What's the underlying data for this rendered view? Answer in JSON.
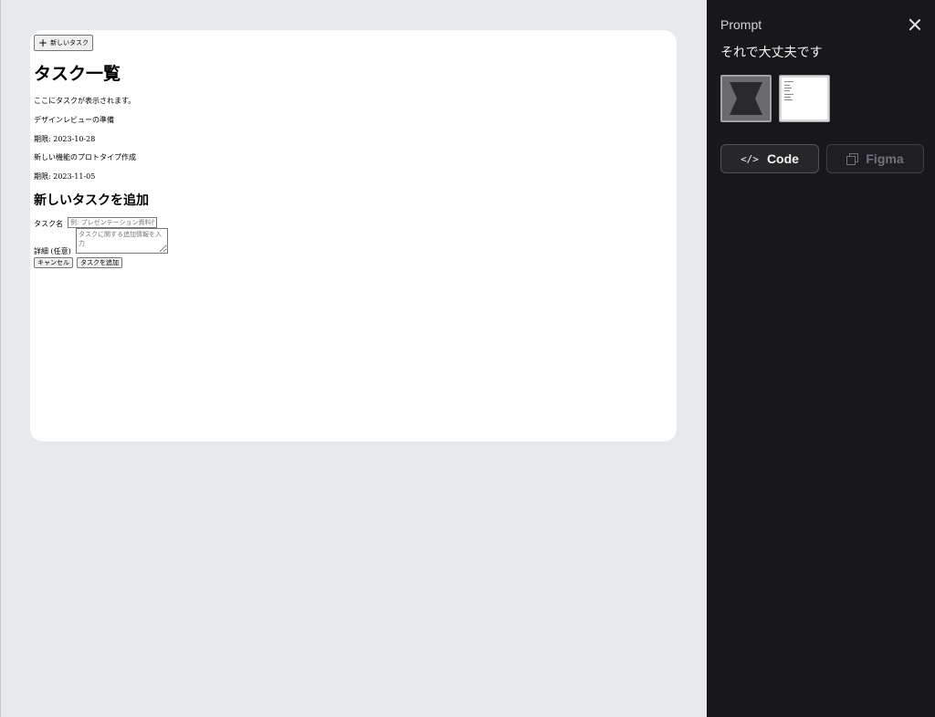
{
  "preview": {
    "new_task_button": "新しいタスク",
    "heading": "タスク一覧",
    "placeholder_text": "ここにタスクが表示されます。",
    "tasks": [
      {
        "title": "デザインレビューの準備",
        "due": "期限: 2023-10-28"
      },
      {
        "title": "新しい機能のプロトタイプ作成",
        "due": "期限: 2023-11-05"
      }
    ],
    "form": {
      "heading": "新しいタスクを追加",
      "name_label": "タスク名",
      "name_placeholder": "例: プレゼンテーション資料作成",
      "detail_label": "詳細 (任意)",
      "detail_placeholder": "タスクに関する追加情報を入力",
      "cancel_label": "キャンセル",
      "submit_label": "タスクを追加"
    }
  },
  "panel": {
    "title": "Prompt",
    "prompt_text": "それで大丈夫です",
    "code_label": "Code",
    "figma_label": "Figma",
    "code_icon": "</>",
    "accent_color": "#18181b"
  }
}
